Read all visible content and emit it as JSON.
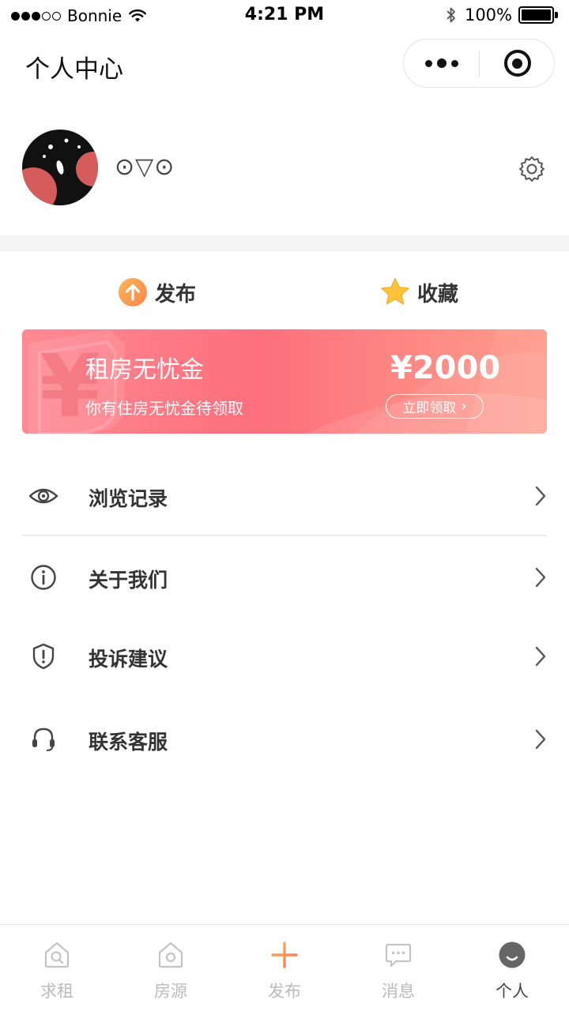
{
  "status_bar": {
    "carrier": "Bonnie",
    "time": "4:21 PM",
    "battery": "100%",
    "signal_bars_filled": 3,
    "signal_bars_total": 5
  },
  "nav": {
    "title": "个人中心"
  },
  "profile": {
    "nickname": "⊙▽⊙"
  },
  "actions": {
    "publish_label": "发布",
    "favorites_label": "收藏"
  },
  "banner": {
    "title": "租房无忧金",
    "subtitle": "你有住房无忧金待领取",
    "amount": "¥2000",
    "button_label": "立即领取"
  },
  "menu": {
    "items": [
      {
        "label": "浏览记录",
        "icon": "eye-icon"
      },
      {
        "label": "关于我们",
        "icon": "info-icon"
      },
      {
        "label": "投诉建议",
        "icon": "shield-alert-icon"
      },
      {
        "label": "联系客服",
        "icon": "headset-icon"
      }
    ]
  },
  "tab_bar": {
    "tabs": [
      {
        "label": "求租",
        "icon": "search-house-icon",
        "active": false
      },
      {
        "label": "房源",
        "icon": "house-icon",
        "active": false
      },
      {
        "label": "发布",
        "icon": "plus-icon",
        "active": false
      },
      {
        "label": "消息",
        "icon": "message-icon",
        "active": false
      },
      {
        "label": "个人",
        "icon": "profile-icon",
        "active": true
      }
    ]
  },
  "colors": {
    "banner_pink": "#fd6f7c",
    "publish_orange": "#f9a04b",
    "star_yellow": "#ffc23a",
    "plus_orange": "#fb8a4c",
    "tab_active": "#444444",
    "tab_inactive": "#bbbbbb"
  }
}
